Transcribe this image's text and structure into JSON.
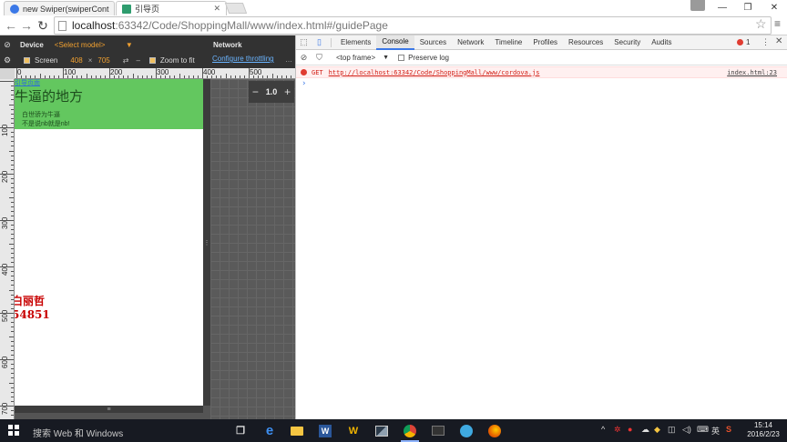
{
  "browser": {
    "tabs": [
      {
        "title": "new Swiper(swiperCont",
        "active": false,
        "favicon_color": "#3b78e7"
      },
      {
        "title": "引导页",
        "active": true,
        "favicon_color": "#2e9c6e"
      }
    ],
    "url_host": "localhost",
    "url_path": ":63342/Code/ShoppingMall/www/index.html#/guidePage"
  },
  "emulation": {
    "device_label": "Device",
    "model_placeholder": "<Select model>",
    "network_label": "Network",
    "screen_label": "Screen",
    "width": "408",
    "height": "705",
    "times": "×",
    "zoom_to_fit_label": "Zoom to fit",
    "throttling_link": "Configure throttling",
    "zoom_value": "1.0",
    "ruler_h_labels": [
      "0",
      "100",
      "200",
      "300",
      "400",
      "500"
    ],
    "ruler_v_labels": [
      "100",
      "200",
      "300",
      "400",
      "500",
      "600",
      "700"
    ]
  },
  "page": {
    "top_link": "引导页面",
    "title": "牛逼的地方",
    "line1": "白世骄为牛逼",
    "line2": "不是说nb就是nb!",
    "watermark_line1": "白丽哲",
    "watermark_line2": "54851",
    "hero_color": "#63c75f"
  },
  "devtools": {
    "tabs": [
      "Elements",
      "Console",
      "Sources",
      "Network",
      "Timeline",
      "Profiles",
      "Resources",
      "Security",
      "Audits"
    ],
    "active_tab": "Console",
    "error_count": "1",
    "frame_selector": "<top frame>",
    "preserve_log_label": "Preserve log",
    "console_errors": [
      {
        "method": "GET",
        "url": "http://localhost:63342/Code/ShoppingMall/www/cordova.js",
        "source": "index.html:23"
      }
    ],
    "prompt": "›"
  },
  "taskbar": {
    "search_placeholder": "搜索 Web 和 Windows",
    "tray_ime": "英",
    "time": "15:14",
    "date": "2016/2/23"
  }
}
